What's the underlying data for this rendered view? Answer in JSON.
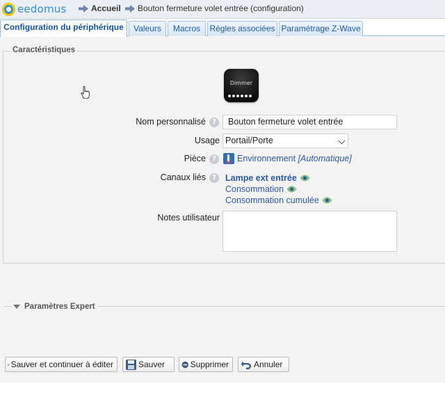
{
  "header": {
    "logo_text": "eedomus",
    "breadcrumb": [
      {
        "label": "Accueil"
      },
      {
        "label": "Bouton fermeture volet entrée (configuration)"
      }
    ]
  },
  "tabs": [
    {
      "label": "Configuration du périphérique",
      "active": true
    },
    {
      "label": "Valeurs",
      "active": false
    },
    {
      "label": "Macros",
      "active": false
    },
    {
      "label": "Règles associées",
      "active": false
    },
    {
      "label": "Paramétrage Z-Wave",
      "active": false
    }
  ],
  "characteristics": {
    "legend": "Caractéristiques",
    "device_image_text": "Dimmer",
    "custom_name": {
      "label": "Nom personnalisé",
      "value": "Bouton fermeture volet entrée"
    },
    "usage": {
      "label": "Usage",
      "value": "Portail/Porte"
    },
    "room": {
      "label": "Pièce",
      "value": "Environnement",
      "auto": "[Automatique]"
    },
    "linked_channels": {
      "label": "Canaux liés",
      "items": [
        "Lampe ext entrée",
        "Consommation",
        "Consommation cumulée"
      ]
    },
    "user_notes": {
      "label": "Notes utilisateur",
      "value": ""
    }
  },
  "expert": {
    "label": "Paramètres Expert"
  },
  "buttons": {
    "save_continue": "Sauver et continuer à éditer",
    "save": "Sauver",
    "delete": "Supprimer",
    "cancel": "Annuler"
  },
  "colors": {
    "accent": "#2a5a9f",
    "tab_active": "#15539c",
    "logo_blue": "#2e8fd6",
    "logo_yellow": "#f2c400",
    "panel_bg": "#f3f3f3"
  }
}
